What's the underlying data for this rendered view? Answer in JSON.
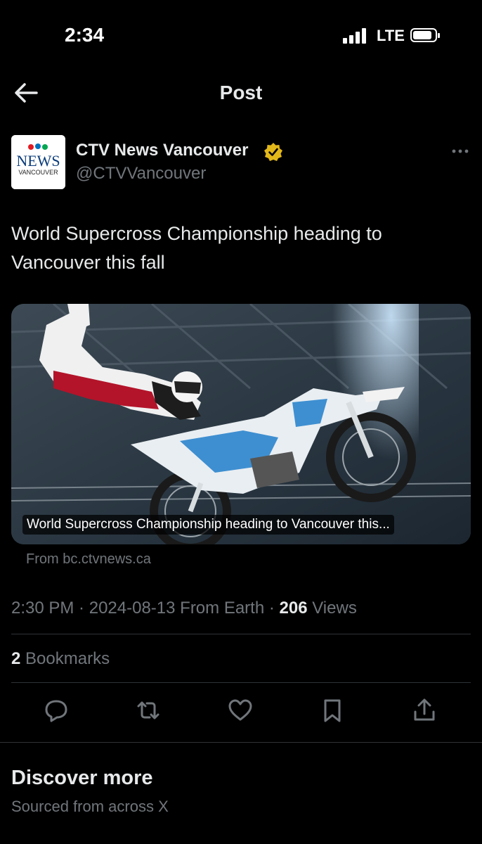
{
  "status_bar": {
    "time": "2:34",
    "network": "LTE"
  },
  "nav": {
    "title": "Post"
  },
  "author": {
    "name": "CTV News Vancouver",
    "handle": "@CTVVancouver",
    "logo_top": "CTV",
    "logo_main": "NEWS",
    "logo_sub": "VANCOUVER"
  },
  "post": {
    "text": "World Supercross Championship heading to Vancouver this fall",
    "media_caption": "World Supercross Championship heading to Vancouver this...",
    "source": "From bc.ctvnews.ca"
  },
  "meta": {
    "time": "2:30 PM",
    "date": "2024-08-13",
    "location": "From Earth",
    "views_count": "206",
    "views_label": "Views"
  },
  "bookmarks": {
    "count": "2",
    "label": "Bookmarks"
  },
  "actions": [
    "reply-icon",
    "repost-icon",
    "like-icon",
    "bookmark-icon",
    "share-icon"
  ],
  "discover": {
    "title": "Discover more",
    "subtitle": "Sourced from across X"
  },
  "colors": {
    "background": "#000000",
    "text": "#e7e9ea",
    "secondary": "#71767b",
    "divider": "#2f3336",
    "verified_gold": "#e2b719"
  }
}
